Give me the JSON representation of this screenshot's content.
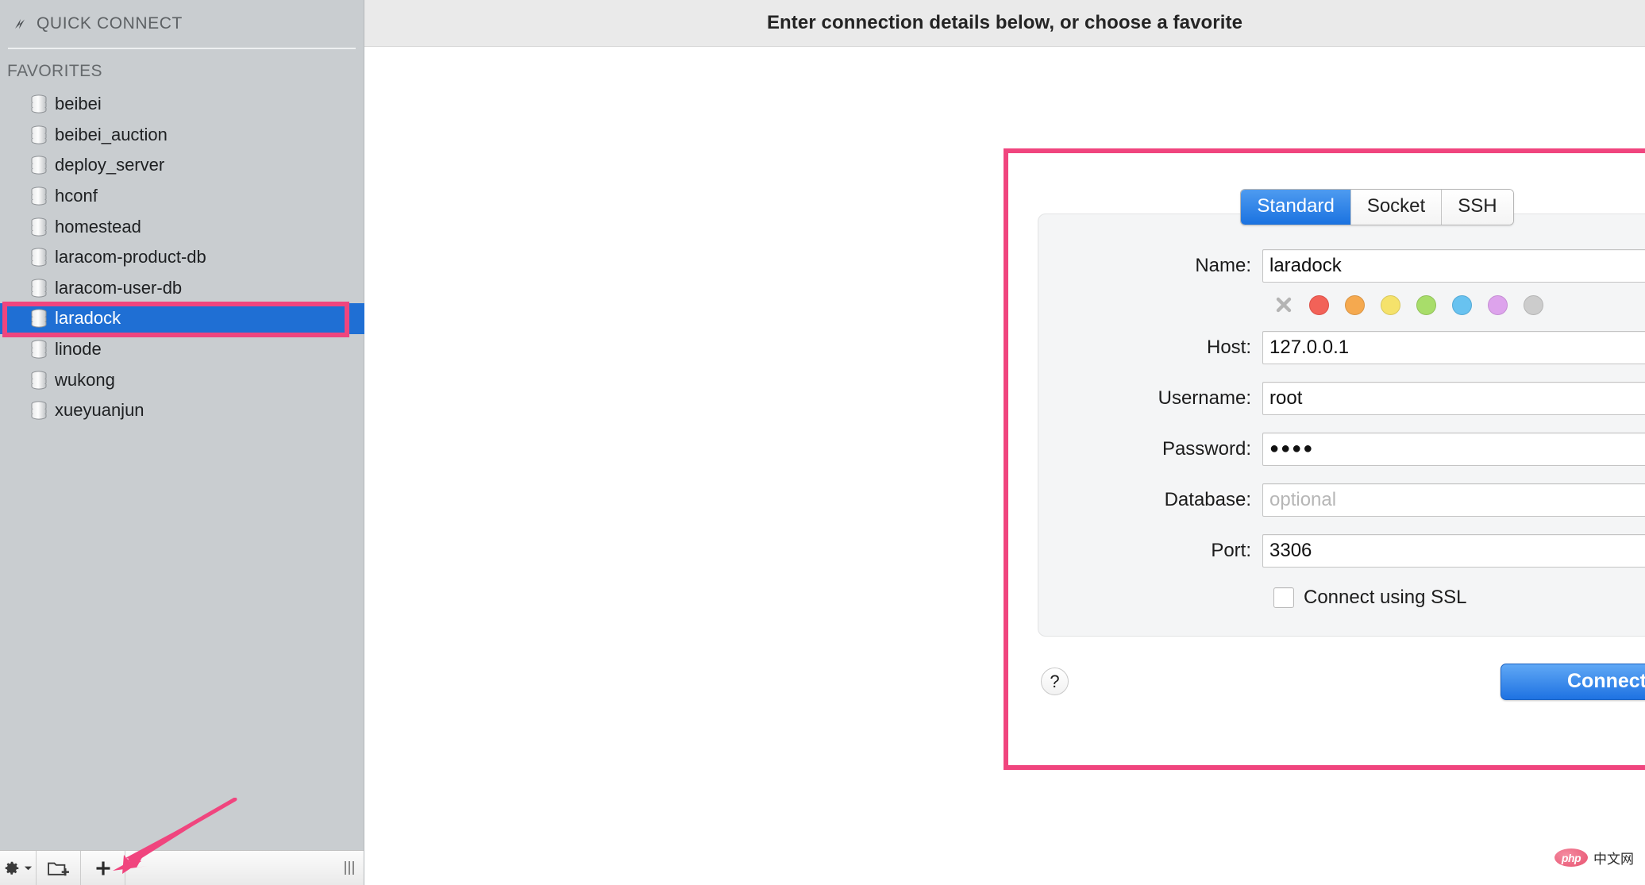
{
  "sidebar": {
    "quick_connect": {
      "label": "QUICK CONNECT",
      "icon": "lightning-bolt-icon"
    },
    "favorites_header": "FAVORITES",
    "favorites": [
      {
        "label": "beibei",
        "selected": false
      },
      {
        "label": "beibei_auction",
        "selected": false
      },
      {
        "label": "deploy_server",
        "selected": false
      },
      {
        "label": "hconf",
        "selected": false
      },
      {
        "label": "homestead",
        "selected": false
      },
      {
        "label": "laracom-product-db",
        "selected": false
      },
      {
        "label": "laracom-user-db",
        "selected": false
      },
      {
        "label": "laradock",
        "selected": true
      },
      {
        "label": "linode",
        "selected": false
      },
      {
        "label": "wukong",
        "selected": false
      },
      {
        "label": "xueyuanjun",
        "selected": false
      }
    ],
    "toolbar": {
      "settings_icon": "gear-icon",
      "settings_caret": "chevron-down-icon",
      "new_folder_icon": "new-folder-icon",
      "add_icon": "plus-icon",
      "resize_grip": "resize-grip-icon"
    }
  },
  "header": {
    "title": "Enter connection details below, or choose a favorite"
  },
  "form": {
    "tabs": [
      {
        "label": "Standard",
        "active": true
      },
      {
        "label": "Socket",
        "active": false
      },
      {
        "label": "SSH",
        "active": false
      }
    ],
    "fields": [
      {
        "label": "Name:",
        "value": "laradock",
        "placeholder": "",
        "type": "text"
      },
      {
        "label": "Host:",
        "value": "127.0.0.1",
        "placeholder": "",
        "type": "text"
      },
      {
        "label": "Username:",
        "value": "root",
        "placeholder": "",
        "type": "text"
      },
      {
        "label": "Password:",
        "value": "●●●●",
        "placeholder": "",
        "type": "password"
      },
      {
        "label": "Database:",
        "value": "",
        "placeholder": "optional",
        "type": "text"
      },
      {
        "label": "Port:",
        "value": "3306",
        "placeholder": "",
        "type": "text"
      }
    ],
    "color_swatches": [
      {
        "name": "none",
        "color": "#b4b4b4"
      },
      {
        "name": "red",
        "color": "#f26258"
      },
      {
        "name": "orange",
        "color": "#f5a council"
      },
      {
        "name": "yellow",
        "color": "#f5e26b"
      },
      {
        "name": "green",
        "color": "#a8dd6a"
      },
      {
        "name": "blue",
        "color": "#68c2f0"
      },
      {
        "name": "purple",
        "color": "#dda3ec"
      },
      {
        "name": "gray",
        "color": "#cccccc"
      }
    ],
    "ssl_checkbox": {
      "label": "Connect using SSL",
      "checked": false
    },
    "help_label": "?",
    "connect_label": "Connect"
  },
  "annotations": {
    "highlight_color": "#f0457e",
    "sidebar_target": "laradock",
    "arrow_target": "add-favorite-button"
  },
  "watermark": {
    "badge": "php",
    "text": "中文网"
  }
}
